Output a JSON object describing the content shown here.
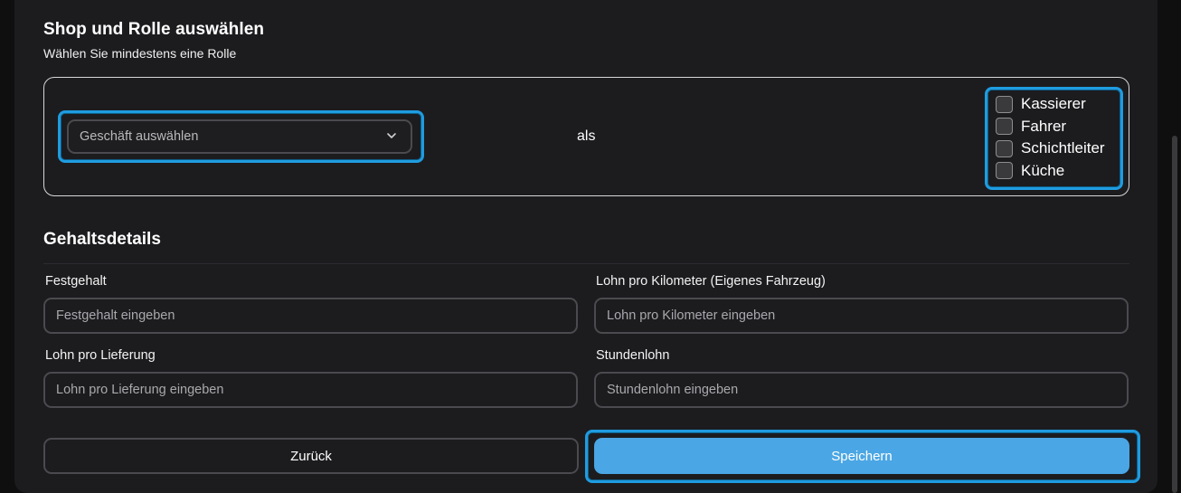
{
  "shop_section": {
    "title": "Shop und Rolle auswählen",
    "subtitle": "Wählen Sie mindestens eine Rolle",
    "shop_select": {
      "value": "Geschäft auswählen"
    },
    "connector": "als",
    "roles": [
      {
        "label": "Kassierer",
        "checked": false
      },
      {
        "label": "Fahrer",
        "checked": false
      },
      {
        "label": "Schichtleiter",
        "checked": false
      },
      {
        "label": "Küche",
        "checked": false
      }
    ]
  },
  "salary_section": {
    "title": "Gehaltsdetails",
    "fields": [
      {
        "label": "Festgehalt",
        "placeholder": "Festgehalt eingeben",
        "value": ""
      },
      {
        "label": "Lohn pro Kilometer (Eigenes Fahrzeug)",
        "placeholder": "Lohn pro Kilometer eingeben",
        "value": ""
      },
      {
        "label": "Lohn pro Lieferung",
        "placeholder": "Lohn pro Lieferung eingeben",
        "value": ""
      },
      {
        "label": "Stundenlohn",
        "placeholder": "Stundenlohn eingeben",
        "value": ""
      }
    ]
  },
  "actions": {
    "back_label": "Zurück",
    "save_label": "Speichern"
  },
  "colors": {
    "accent": "#4aa6e4",
    "highlight": "#1f9ce0",
    "panel": "#1c1c1f"
  },
  "icons": {
    "select_arrow": "chevron-down-icon"
  }
}
